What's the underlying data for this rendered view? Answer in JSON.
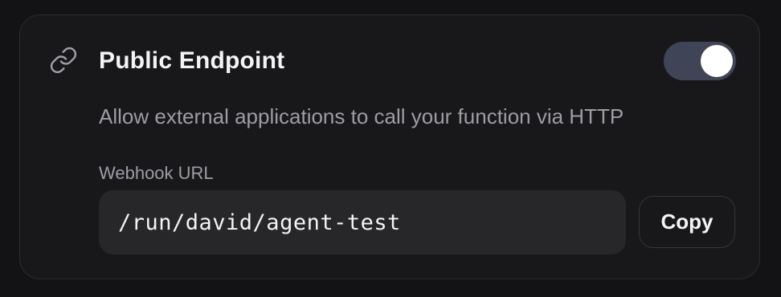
{
  "endpoint": {
    "icon": "link-icon",
    "title": "Public Endpoint",
    "enabled": true,
    "description": "Allow external applications to call your function via HTTP"
  },
  "webhook": {
    "label": "Webhook URL",
    "url": "/run/david/agent-test",
    "copy_label": "Copy"
  },
  "colors": {
    "background": "#131315",
    "card": "#18181b",
    "toggle_on": "#3f4556",
    "input_bg": "#27272a",
    "text_primary": "#f4f4f5",
    "text_secondary": "#9d9da4"
  }
}
